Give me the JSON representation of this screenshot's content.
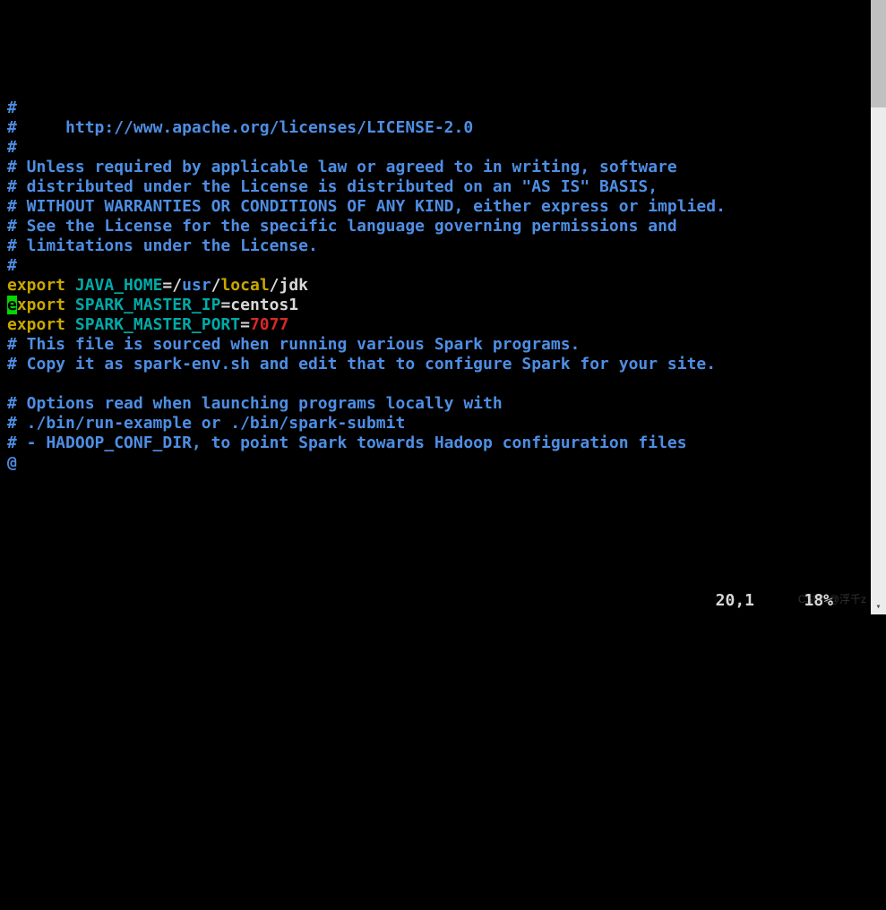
{
  "lines": {
    "l1": "#",
    "l2a": "#     ",
    "l2b": "http://www.apache.org/licenses/LICENSE-2.0",
    "l3": "#",
    "l4": "# Unless required by applicable law or agreed to in writing, software",
    "l5": "# distributed under the License is distributed on an \"AS IS\" BASIS,",
    "l6": "# WITHOUT WARRANTIES OR CONDITIONS OF ANY KIND, either express or implied.",
    "l7": "# See the License for the specific language governing permissions and",
    "l8": "# limitations under the License.",
    "l9": "#",
    "e1_kw": "export",
    "e1_sp": " ",
    "e1_var": "JAVA_HOME",
    "e1_eq": "=/",
    "e1_p1": "usr",
    "e1_s1": "/",
    "e1_p2": "local",
    "e1_s2": "/",
    "e1_p3": "jdk",
    "e2_cursor": "e",
    "e2_kw": "xport",
    "e2_sp": " ",
    "e2_var": "SPARK_MASTER_IP",
    "e2_eq": "=",
    "e2_val": "centos1",
    "e3_kw": "export",
    "e3_sp": " ",
    "e3_var": "SPARK_MASTER_PORT",
    "e3_eq": "=",
    "e3_val": "7077",
    "l10": "# This file is sourced when running various Spark programs.",
    "l11": "# Copy it as spark-env.sh and edit that to configure Spark for your site.",
    "l12": "",
    "l13": "# Options read when launching programs locally with",
    "l14": "# ./bin/run-example or ./bin/spark-submit",
    "l15": "# - HADOOP_CONF_DIR, to point Spark towards Hadoop configuration files",
    "at": "@"
  },
  "status": {
    "position": "20,1",
    "percent": "18%"
  },
  "watermark": "CSDN@浮千z"
}
